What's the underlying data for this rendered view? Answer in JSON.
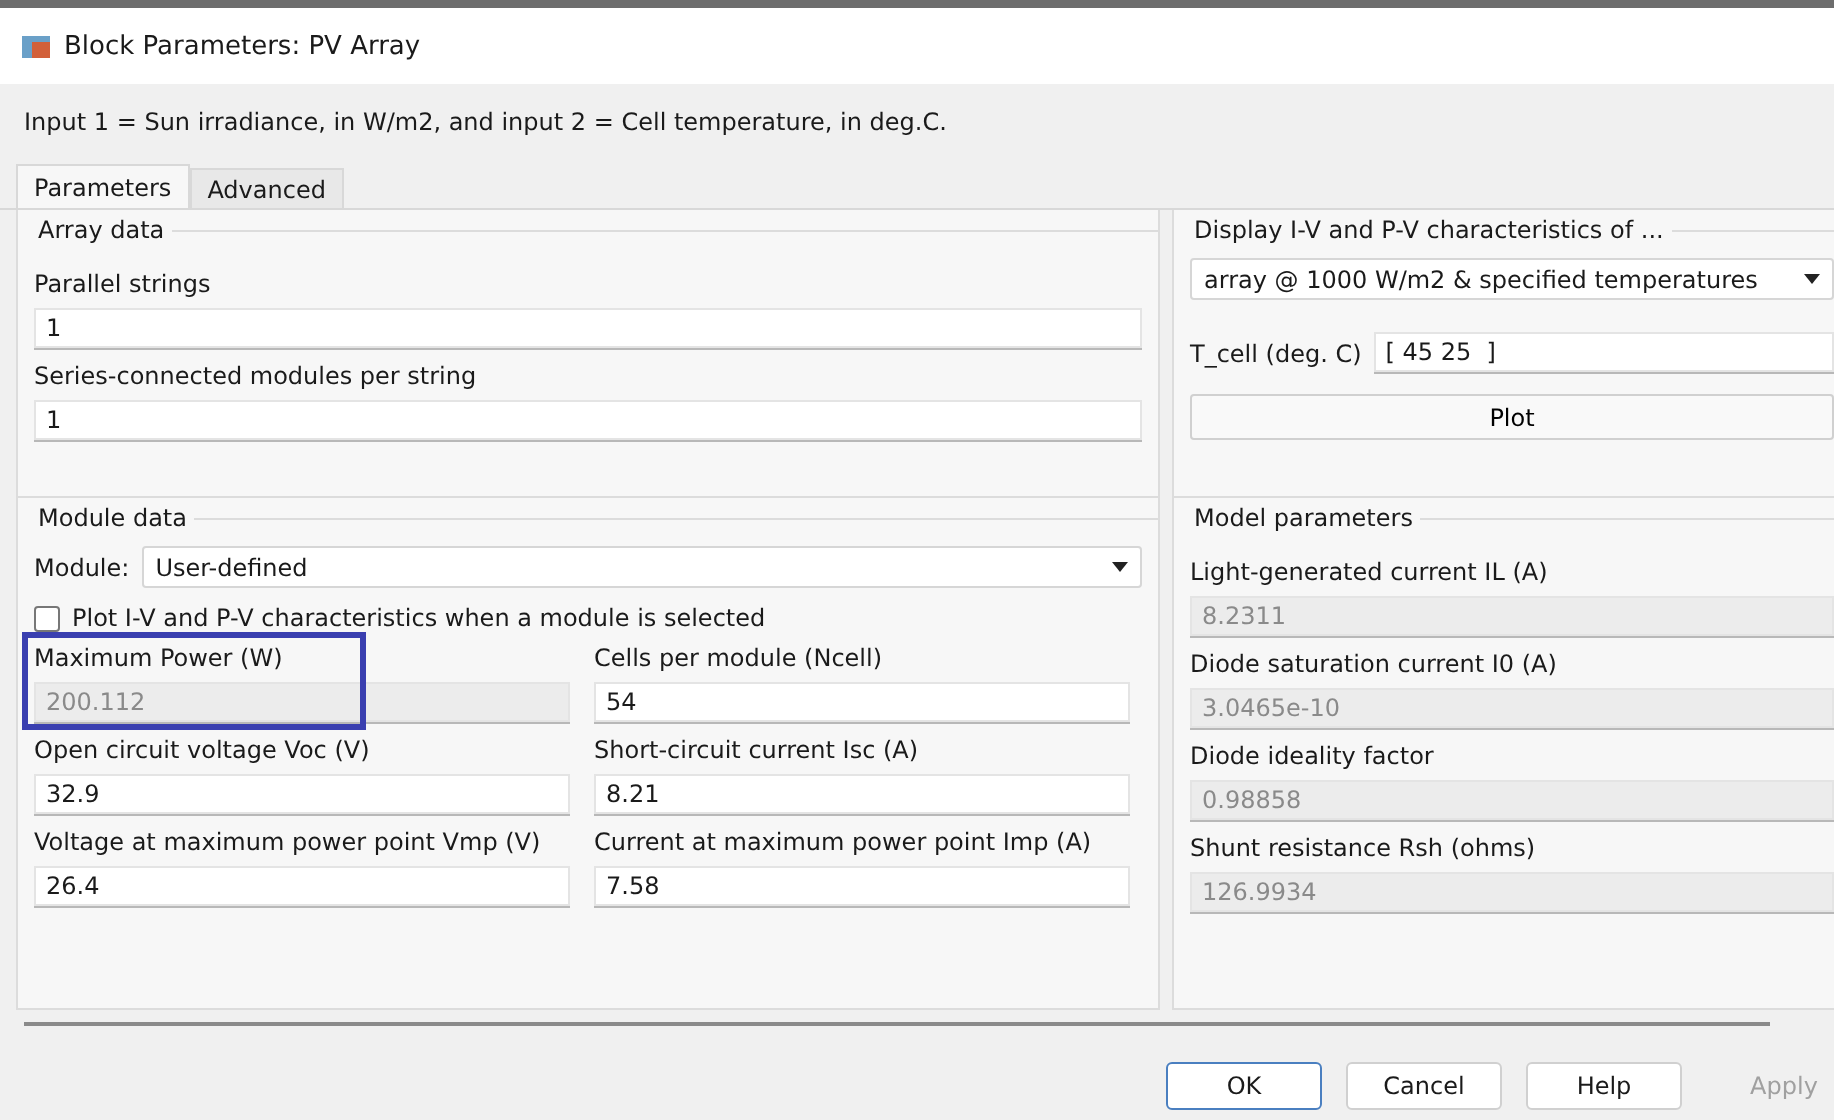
{
  "window": {
    "title": "Block Parameters: PV Array"
  },
  "description": "Input 1 = Sun irradiance, in W/m2, and input 2 = Cell temperature, in deg.C.",
  "tabs": [
    {
      "label": "Parameters",
      "selected": true
    },
    {
      "label": "Advanced",
      "selected": false
    }
  ],
  "array_data": {
    "title": "Array data",
    "fields": [
      {
        "label": "Parallel strings",
        "value": "1"
      },
      {
        "label": "Series-connected modules per string",
        "value": "1"
      }
    ]
  },
  "module_data": {
    "title": "Module data",
    "module_label": "Module:",
    "module_value": "User-defined",
    "checkbox": {
      "label": "Plot I-V and P-V characteristics when a module is selected",
      "checked": false
    },
    "fields": [
      {
        "label": "Maximum Power (W)",
        "value": "200.112",
        "disabled": true,
        "highlighted": true
      },
      {
        "label": "Cells per module (Ncell)",
        "value": "54",
        "disabled": false,
        "highlighted": false
      },
      {
        "label": "Open circuit voltage  Voc (V)",
        "value": "32.9",
        "disabled": false,
        "highlighted": false
      },
      {
        "label": "Short-circuit current Isc (A)",
        "value": "8.21",
        "disabled": false,
        "highlighted": false
      },
      {
        "label": "Voltage at maximum power point Vmp (V)",
        "value": "26.4",
        "disabled": false,
        "highlighted": false
      },
      {
        "label": "Current at maximum power point Imp (A)",
        "value": "7.58",
        "disabled": false,
        "highlighted": false
      }
    ]
  },
  "display": {
    "title": "Display  I-V and P-V characteristics of ...",
    "option": "array @ 1000 W/m2 & specified temperatures",
    "tcell_label": "T_cell (deg. C)",
    "tcell_value": "[ 45 25  ]",
    "plot_button": "Plot"
  },
  "model_parameters": {
    "title": "Model parameters",
    "fields": [
      {
        "label": "Light-generated current IL (A)",
        "value": "8.2311",
        "disabled": true
      },
      {
        "label": "Diode saturation current I0 (A)",
        "value": "3.0465e-10",
        "disabled": true
      },
      {
        "label": "Diode ideality factor",
        "value": "0.98858",
        "disabled": true
      },
      {
        "label": "Shunt resistance Rsh (ohms)",
        "value": "126.9934",
        "disabled": true
      }
    ]
  },
  "buttons": [
    {
      "label": "OK",
      "default": true,
      "disabled": false
    },
    {
      "label": "Cancel",
      "default": false,
      "disabled": false
    },
    {
      "label": "Help",
      "default": false,
      "disabled": false
    },
    {
      "label": "Apply",
      "default": false,
      "disabled": true
    }
  ]
}
